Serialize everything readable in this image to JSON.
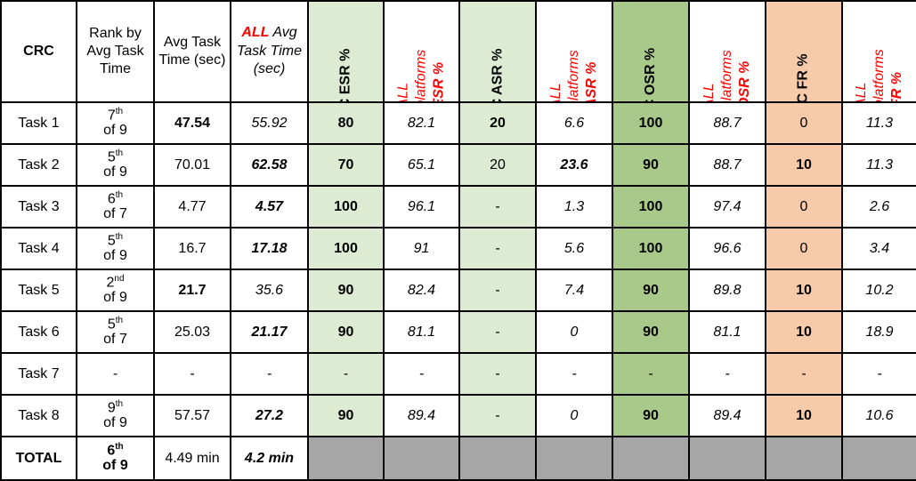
{
  "table": {
    "corner_label": "CRC",
    "columns": [
      {
        "id": "task",
        "label": "CRC",
        "type": "corner"
      },
      {
        "id": "rank",
        "label": "Rank by Avg Task Time",
        "type": "plain"
      },
      {
        "id": "crc_time",
        "label": "Avg Task Time (sec)",
        "type": "plain"
      },
      {
        "id": "all_time",
        "label_prefix": "ALL",
        "label_rest": "Avg Task Time (sec)",
        "type": "all"
      },
      {
        "id": "crc_esr",
        "label": "CRC ESR %",
        "type": "rot-black",
        "fill": "#ddebd3"
      },
      {
        "id": "all_esr",
        "label_prefix": "ALL platforms",
        "label_rest": "ESR %",
        "type": "rot-red",
        "fill": "#ffffff"
      },
      {
        "id": "crc_asr",
        "label": "CRC ASR %",
        "type": "rot-black",
        "fill": "#ddebd3"
      },
      {
        "id": "all_asr",
        "label_prefix": "ALL platforms",
        "label_rest": "ASR %",
        "type": "rot-red",
        "fill": "#ffffff"
      },
      {
        "id": "crc_osr",
        "label": "CRC OSR %",
        "type": "rot-black",
        "fill": "#a9c98a"
      },
      {
        "id": "all_osr",
        "label_prefix": "ALL platforms",
        "label_rest": "OSR %",
        "type": "rot-red",
        "fill": "#ffffff"
      },
      {
        "id": "crc_fr",
        "label": "CRC FR %",
        "type": "rot-black",
        "fill": "#f7cbaa"
      },
      {
        "id": "all_fr",
        "label_prefix": "ALL platforms",
        "label_rest": "FR %",
        "type": "rot-red",
        "fill": "#ffffff"
      }
    ],
    "rows": [
      {
        "task": "Task 1",
        "rank_ordinal": "7",
        "rank_suffix": "th",
        "rank_of": "of 9",
        "rank_bold": false,
        "crc_time": "47.54",
        "crc_time_bold": true,
        "all_time": "55.92",
        "all_time_bold": false,
        "crc_esr": "80",
        "crc_esr_bold": true,
        "all_esr": "82.1",
        "all_esr_bold": false,
        "crc_asr": "20",
        "crc_asr_bold": true,
        "all_asr": "6.6",
        "all_asr_bold": false,
        "crc_osr": "100",
        "crc_osr_bold": true,
        "all_osr": "88.7",
        "all_osr_bold": false,
        "crc_fr": "0",
        "crc_fr_bold": false,
        "all_fr": "11.3",
        "all_fr_bold": false
      },
      {
        "task": "Task 2",
        "rank_ordinal": "5",
        "rank_suffix": "th",
        "rank_of": "of 9",
        "rank_bold": false,
        "crc_time": "70.01",
        "crc_time_bold": false,
        "all_time": "62.58",
        "all_time_bold": true,
        "crc_esr": "70",
        "crc_esr_bold": true,
        "all_esr": "65.1",
        "all_esr_bold": false,
        "crc_asr": "20",
        "crc_asr_bold": false,
        "all_asr": "23.6",
        "all_asr_bold": true,
        "crc_osr": "90",
        "crc_osr_bold": true,
        "all_osr": "88.7",
        "all_osr_bold": false,
        "crc_fr": "10",
        "crc_fr_bold": true,
        "all_fr": "11.3",
        "all_fr_bold": false
      },
      {
        "task": "Task 3",
        "rank_ordinal": "6",
        "rank_suffix": "th",
        "rank_of": "of 7",
        "rank_bold": false,
        "crc_time": "4.77",
        "crc_time_bold": false,
        "all_time": "4.57",
        "all_time_bold": true,
        "crc_esr": "100",
        "crc_esr_bold": true,
        "all_esr": "96.1",
        "all_esr_bold": false,
        "crc_asr": "-",
        "crc_asr_bold": false,
        "all_asr": "1.3",
        "all_asr_bold": false,
        "crc_osr": "100",
        "crc_osr_bold": true,
        "all_osr": "97.4",
        "all_osr_bold": false,
        "crc_fr": "0",
        "crc_fr_bold": false,
        "all_fr": "2.6",
        "all_fr_bold": false
      },
      {
        "task": "Task 4",
        "rank_ordinal": "5",
        "rank_suffix": "th",
        "rank_of": "of 9",
        "rank_bold": false,
        "crc_time": "16.7",
        "crc_time_bold": false,
        "all_time": "17.18",
        "all_time_bold": true,
        "crc_esr": "100",
        "crc_esr_bold": true,
        "all_esr": "91",
        "all_esr_bold": false,
        "crc_asr": "-",
        "crc_asr_bold": false,
        "all_asr": "5.6",
        "all_asr_bold": false,
        "crc_osr": "100",
        "crc_osr_bold": true,
        "all_osr": "96.6",
        "all_osr_bold": false,
        "crc_fr": "0",
        "crc_fr_bold": false,
        "all_fr": "3.4",
        "all_fr_bold": false
      },
      {
        "task": "Task 5",
        "rank_ordinal": "2",
        "rank_suffix": "nd",
        "rank_of": "of 9",
        "rank_bold": false,
        "crc_time": "21.7",
        "crc_time_bold": true,
        "all_time": "35.6",
        "all_time_bold": false,
        "crc_esr": "90",
        "crc_esr_bold": true,
        "all_esr": "82.4",
        "all_esr_bold": false,
        "crc_asr": "-",
        "crc_asr_bold": false,
        "all_asr": "7.4",
        "all_asr_bold": false,
        "crc_osr": "90",
        "crc_osr_bold": true,
        "all_osr": "89.8",
        "all_osr_bold": false,
        "crc_fr": "10",
        "crc_fr_bold": true,
        "all_fr": "10.2",
        "all_fr_bold": false
      },
      {
        "task": "Task 6",
        "rank_ordinal": "5",
        "rank_suffix": "th",
        "rank_of": "of 7",
        "rank_bold": false,
        "crc_time": "25.03",
        "crc_time_bold": false,
        "all_time": "21.17",
        "all_time_bold": true,
        "crc_esr": "90",
        "crc_esr_bold": true,
        "all_esr": "81.1",
        "all_esr_bold": false,
        "crc_asr": "-",
        "crc_asr_bold": false,
        "all_asr": "0",
        "all_asr_bold": false,
        "crc_osr": "90",
        "crc_osr_bold": true,
        "all_osr": "81.1",
        "all_osr_bold": false,
        "crc_fr": "10",
        "crc_fr_bold": true,
        "all_fr": "18.9",
        "all_fr_bold": false
      },
      {
        "task": "Task 7",
        "rank_ordinal": "",
        "rank_suffix": "",
        "rank_of": "",
        "rank_dash": "-",
        "rank_bold": false,
        "crc_time": "-",
        "crc_time_bold": false,
        "all_time": "-",
        "all_time_bold": false,
        "crc_esr": "-",
        "crc_esr_bold": false,
        "all_esr": "-",
        "all_esr_bold": false,
        "crc_asr": "-",
        "crc_asr_bold": false,
        "all_asr": "-",
        "all_asr_bold": false,
        "crc_osr": "-",
        "crc_osr_bold": false,
        "all_osr": "-",
        "all_osr_bold": false,
        "crc_fr": "-",
        "crc_fr_bold": false,
        "all_fr": "-",
        "all_fr_bold": false
      },
      {
        "task": "Task 8",
        "rank_ordinal": "9",
        "rank_suffix": "th",
        "rank_of": "of 9",
        "rank_bold": false,
        "crc_time": "57.57",
        "crc_time_bold": false,
        "all_time": "27.2",
        "all_time_bold": true,
        "crc_esr": "90",
        "crc_esr_bold": true,
        "all_esr": "89.4",
        "all_esr_bold": false,
        "crc_asr": "-",
        "crc_asr_bold": false,
        "all_asr": "0",
        "all_asr_bold": false,
        "crc_osr": "90",
        "crc_osr_bold": true,
        "all_osr": "89.4",
        "all_osr_bold": false,
        "crc_fr": "10",
        "crc_fr_bold": true,
        "all_fr": "10.6",
        "all_fr_bold": false
      },
      {
        "task": "TOTAL",
        "is_total": true,
        "rank_ordinal": "6",
        "rank_suffix": "th",
        "rank_of": "of 9",
        "rank_bold": true,
        "crc_time": "4.49 min",
        "crc_time_bold": false,
        "all_time": "4.2 min",
        "all_time_bold": true,
        "crc_esr": "",
        "all_esr": "",
        "crc_asr": "",
        "all_asr": "",
        "crc_osr": "",
        "all_osr": "",
        "crc_fr": "",
        "all_fr": ""
      }
    ]
  },
  "colors": {
    "corner_bg": "#000000",
    "light_green": "#ddebd3",
    "dark_green": "#a9c98a",
    "orange": "#f7cbaa",
    "gray": "#a6a6a6",
    "red_accent": "#ff0000",
    "border": "#000000"
  }
}
